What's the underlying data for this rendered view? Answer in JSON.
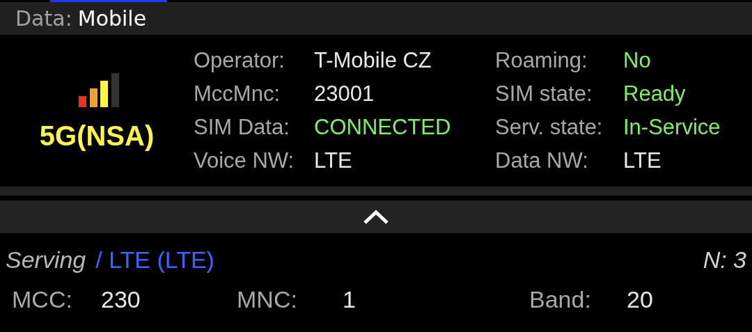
{
  "header": {
    "label": "Data:",
    "value": "Mobile"
  },
  "network": {
    "type": "5G(NSA)"
  },
  "info_left": [
    {
      "label": "Operator:",
      "value": "T-Mobile CZ",
      "color": "#e8e8e8"
    },
    {
      "label": "MccMnc:",
      "value": "23001",
      "color": "#e8e8e8"
    },
    {
      "label": "SIM Data:",
      "value": "CONNECTED",
      "color": "#80f060"
    },
    {
      "label": "Voice NW:",
      "value": "LTE",
      "color": "#e8e8e8"
    }
  ],
  "info_right": [
    {
      "label": "Roaming:",
      "value": "No",
      "color": "#80f060"
    },
    {
      "label": "SIM state:",
      "value": "Ready",
      "color": "#80f060"
    },
    {
      "label": "Serv. state:",
      "value": "In-Service",
      "color": "#80f060"
    },
    {
      "label": "Data NW:",
      "value": "LTE",
      "color": "#e8e8e8"
    }
  ],
  "serving": {
    "title": "Serving",
    "tech": "/ LTE (LTE)",
    "count": "N: 3"
  },
  "cell": [
    {
      "label": "MCC:",
      "value": "230"
    },
    {
      "label": "MNC:",
      "value": "1"
    },
    {
      "label": "Band:",
      "value": "20"
    }
  ]
}
